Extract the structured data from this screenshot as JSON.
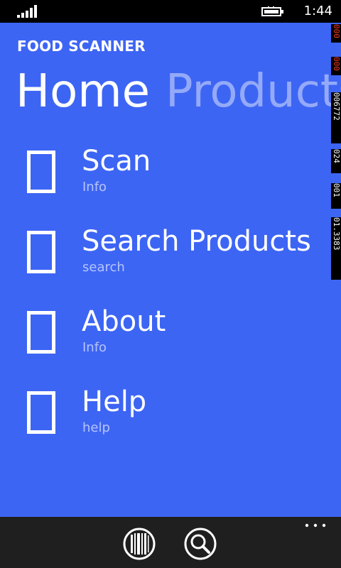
{
  "status_bar": {
    "time": "1:44"
  },
  "app": {
    "title": "FOOD SCANNER",
    "background": "#3d65f4",
    "pivot_tabs": [
      {
        "label": "Home",
        "active": true
      },
      {
        "label": "Products",
        "active": false
      }
    ],
    "menu_items": [
      {
        "label": "Scan",
        "subtitle": "Info",
        "icon": "placeholder-box-icon"
      },
      {
        "label": "Search Products",
        "subtitle": "search",
        "icon": "placeholder-box-icon"
      },
      {
        "label": "About",
        "subtitle": "Info",
        "icon": "placeholder-box-icon"
      },
      {
        "label": "Help",
        "subtitle": "help",
        "icon": "placeholder-box-icon"
      }
    ]
  },
  "debug_counters": [
    {
      "text": "000",
      "color": "#ff3b1f"
    },
    {
      "text": "000",
      "color": "#ff3b1f"
    },
    {
      "text": "006772",
      "color": "#ffffff"
    },
    {
      "text": "024",
      "color": "#ffffff"
    },
    {
      "text": "001",
      "color": "#ffffff"
    },
    {
      "text": "01.3383",
      "color": "#ffffff"
    }
  ],
  "app_bar": {
    "buttons": [
      {
        "name": "scan-barcode-button",
        "icon": "barcode-icon"
      },
      {
        "name": "search-button",
        "icon": "search-icon"
      }
    ],
    "more_icon": "more-options-icon"
  }
}
